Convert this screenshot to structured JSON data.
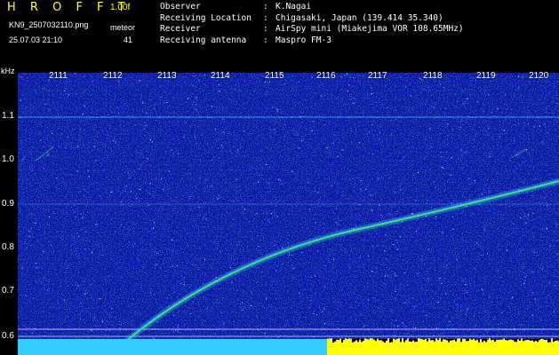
{
  "header": {
    "app_title": "H R O F F T",
    "version": "1.00f",
    "file_name": "KN9_2507032110.png",
    "meteor_label": "meteor",
    "datetime": "25.07.03 21:10",
    "meteor_count": "41"
  },
  "info": [
    {
      "label": "Observer",
      "value": "K.Nagai"
    },
    {
      "label": "Receiving Location",
      "value": "Chigasaki, Japan (139.414 35.340)"
    },
    {
      "label": "Receiver",
      "value": "AirSpy mini (Miakejima VOR 108.65MHz)"
    },
    {
      "label": "Receiving antenna",
      "value": "Maspro FM-3"
    }
  ],
  "separator": ":",
  "axes": {
    "y_unit": "kHz",
    "x_ticks": [
      "2111",
      "2112",
      "2113",
      "2114",
      "2115",
      "2116",
      "2117",
      "2118",
      "2119",
      "2120"
    ],
    "y_ticks": [
      "1.1",
      "1.0",
      "0.9",
      "0.8",
      "0.7",
      "0.6"
    ]
  },
  "colors": {
    "background": "#000000",
    "spectrum_bg": "#0a1aa8",
    "title": "#ffff33",
    "echo": "#39e27a",
    "level_low": "#33ccff",
    "level_high": "#ffff00"
  }
}
